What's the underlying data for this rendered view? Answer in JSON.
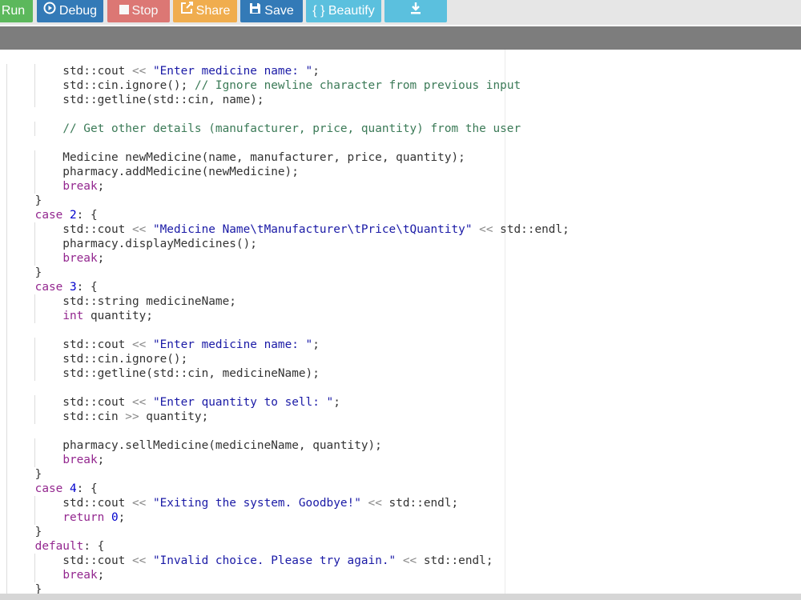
{
  "toolbar": {
    "buttons": [
      {
        "label": "Run",
        "icon": "play-icon"
      },
      {
        "label": "Debug",
        "icon": "debug-icon"
      },
      {
        "label": "Stop",
        "icon": "stop-icon"
      },
      {
        "label": "Share",
        "icon": "share-icon"
      },
      {
        "label": "Save",
        "icon": "save-icon"
      },
      {
        "label": "{ } Beautify",
        "icon": "beautify-icon"
      },
      {
        "label": "",
        "icon": "download-icon"
      }
    ]
  },
  "colors": {
    "run": "#5cb85c",
    "debug": "#337ab7",
    "stop": "#d9534f",
    "share": "#f0ad4e",
    "save": "#337ab7",
    "beautify": "#5bc0de",
    "keyword": "#93278f",
    "string": "#1a1aa6",
    "comment": "#3b7a57"
  },
  "editor": {
    "lines": [
      "        std::cout << \"Enter medicine name: \";",
      "        std::cin.ignore(); // Ignore newline character from previous input",
      "        std::getline(std::cin, name);",
      "",
      "        // Get other details (manufacturer, price, quantity) from the user",
      "",
      "        Medicine newMedicine(name, manufacturer, price, quantity);",
      "        pharmacy.addMedicine(newMedicine);",
      "        break;",
      "    }",
      "    case 2: {",
      "        std::cout << \"Medicine Name\\tManufacturer\\tPrice\\tQuantity\" << std::endl;",
      "        pharmacy.displayMedicines();",
      "        break;",
      "    }",
      "    case 3: {",
      "        std::string medicineName;",
      "        int quantity;",
      "",
      "        std::cout << \"Enter medicine name: \";",
      "        std::cin.ignore();",
      "        std::getline(std::cin, medicineName);",
      "",
      "        std::cout << \"Enter quantity to sell: \";",
      "        std::cin >> quantity;",
      "",
      "        pharmacy.sellMedicine(medicineName, quantity);",
      "        break;",
      "    }",
      "    case 4: {",
      "        std::cout << \"Exiting the system. Goodbye!\" << std::endl;",
      "        return 0;",
      "    }",
      "    default: {",
      "        std::cout << \"Invalid choice. Please try again.\" << std::endl;",
      "        break;",
      "    }"
    ]
  }
}
